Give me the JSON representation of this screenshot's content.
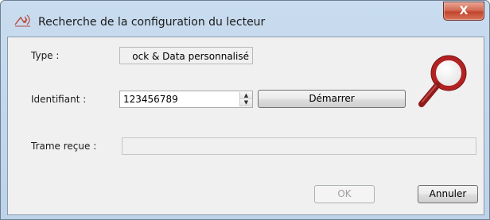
{
  "window": {
    "title": "Recherche de la configuration du lecteur",
    "close_glyph": "X",
    "icon": "sensor-waves-icon"
  },
  "form": {
    "type_label": "Type :",
    "type_value": "ock & Data personnalisé",
    "identifiant_label": "Identifiant :",
    "identifiant_value": "123456789",
    "spin_up": "▲",
    "spin_down": "▼",
    "demarrer_label": "Démarrer",
    "trame_label": "Trame reçue :",
    "trame_value": ""
  },
  "footer": {
    "ok_label": "OK",
    "annuler_label": "Annuler"
  },
  "decor": {
    "magnifier_icon": "magnifier-icon",
    "accent": "#9e1f1f"
  }
}
